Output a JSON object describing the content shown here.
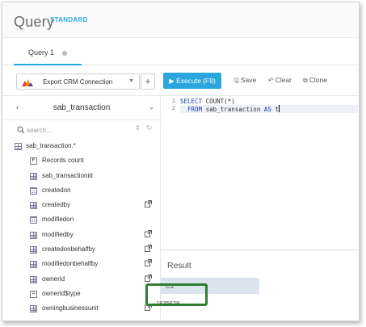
{
  "app": {
    "title": "Query",
    "edition": "STANDARD"
  },
  "tabs": [
    {
      "label": "Query 1"
    }
  ],
  "toolbar": {
    "connection_label": "Export CRM Connection",
    "add_label": "+",
    "execute_label": "Execute (F9)",
    "save_label": "Save",
    "clear_label": "Clear",
    "clone_label": "Clone"
  },
  "table_browser": {
    "prev_label": "‹",
    "table_name": "sab_transaction",
    "next_label": "⌄",
    "search_placeholder": "search...",
    "items": [
      {
        "label": "sab_transaction.*",
        "icon": "table-icon",
        "linked": false
      },
      {
        "label": "Records count",
        "icon": "function-icon",
        "linked": false
      },
      {
        "label": "sab_transactionid",
        "icon": "column-icon",
        "linked": false
      },
      {
        "label": "createdon",
        "icon": "calendar-icon",
        "linked": false
      },
      {
        "label": "createdby",
        "icon": "column-icon",
        "linked": true
      },
      {
        "label": "modifiedon",
        "icon": "calendar-icon",
        "linked": false
      },
      {
        "label": "modifiedby",
        "icon": "column-icon",
        "linked": true
      },
      {
        "label": "createdonbehalfby",
        "icon": "column-icon",
        "linked": true
      },
      {
        "label": "modifiedonbehalfby",
        "icon": "column-icon",
        "linked": true
      },
      {
        "label": "ownerid",
        "icon": "column-icon",
        "linked": true
      },
      {
        "label": "ownerid$type",
        "icon": "text-icon",
        "linked": false
      },
      {
        "label": "owningbusinessunit",
        "icon": "column-icon",
        "linked": true
      }
    ]
  },
  "editor": {
    "lines": [
      {
        "num": "1",
        "parts": [
          {
            "t": "SELECT",
            "k": true
          },
          {
            "t": " COUNT(*)",
            "k": false
          }
        ]
      },
      {
        "num": "2",
        "parts": [
          {
            "t": "  FROM",
            "k": true
          },
          {
            "t": " sab_transaction ",
            "k": false
          },
          {
            "t": "AS",
            "k": true
          },
          {
            "t": " t",
            "k": false
          }
        ]
      }
    ]
  },
  "results": {
    "title": "Result",
    "columns": [
      "C1"
    ],
    "rows": [
      [
        "1835629"
      ]
    ]
  },
  "colors": {
    "accent": "#2aa6de",
    "highlight": "#2e7d32",
    "result_header_bg": "#dbe4ee"
  }
}
